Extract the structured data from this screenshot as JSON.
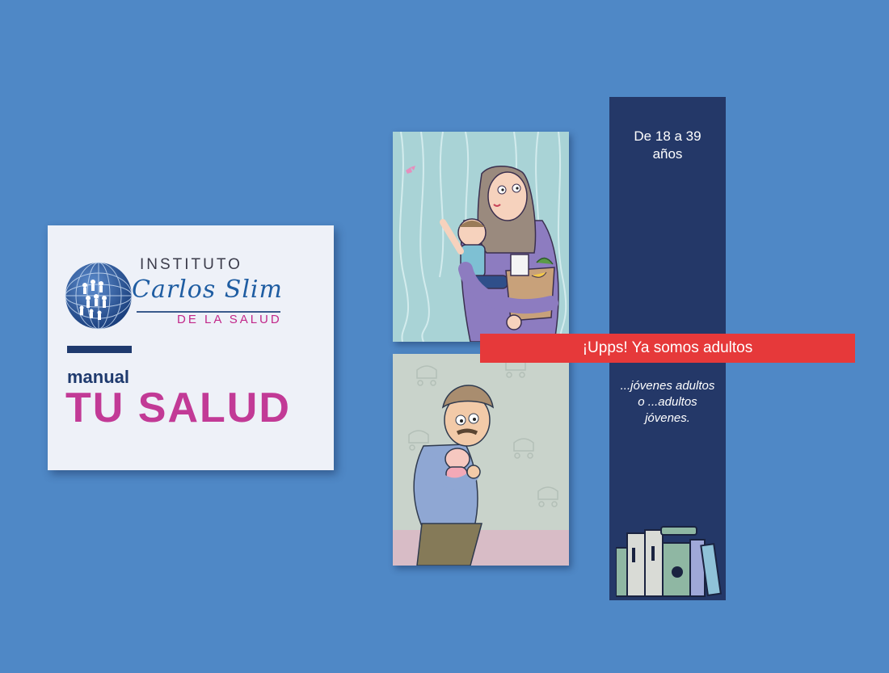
{
  "brand": {
    "line1": "INSTITUTO",
    "line2": "Carlos Slim",
    "line3": "DE LA SALUD",
    "logo_icon": "globe-icon",
    "color_primary": "#1f3a6e",
    "color_accent": "#c23a96"
  },
  "manual": {
    "label": "manual",
    "title": "TU SALUD"
  },
  "illustrations": {
    "top": "mother-with-child-and-groceries",
    "bottom": "father-holding-baby"
  },
  "bookmark": {
    "age_range": "De 18 a 39 años",
    "quote": "...jóvenes adultos o ...adultos jóvenes.",
    "background": "#243868"
  },
  "ribbon": {
    "text": "¡Upps! Ya somos adultos",
    "color": "#e6393a"
  },
  "background_color": "#4f88c6"
}
